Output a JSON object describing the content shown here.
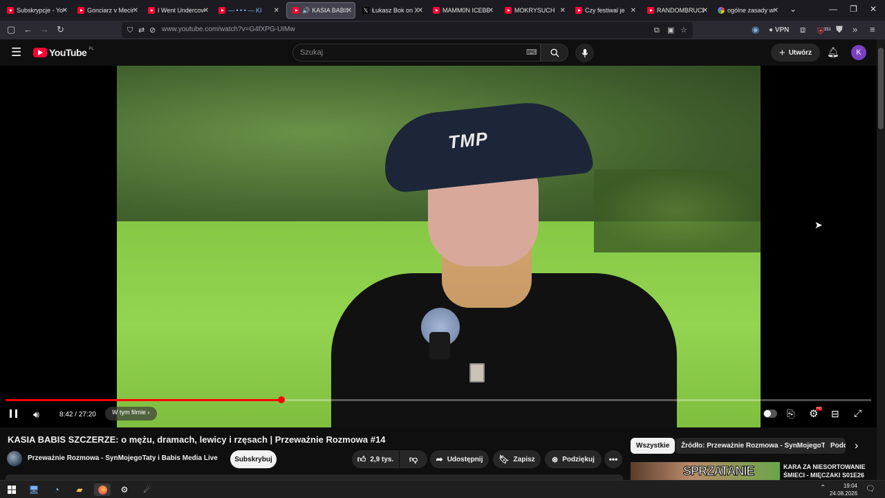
{
  "browser": {
    "tabs": [
      {
        "label": "Subskrypcje - YouT",
        "icon": "youtube-icon"
      },
      {
        "label": "Gonciarz v Mecins",
        "icon": "youtube-icon"
      },
      {
        "label": "I Went Undercove",
        "icon": "youtube-icon"
      },
      {
        "label": "— • • • — KI",
        "icon": "youtube-icon"
      },
      {
        "label": "KASIA BABIS S",
        "icon": "youtube-icon",
        "active": true
      },
      {
        "label": "Łukasz Bok on X: \"",
        "icon": "x-icon"
      },
      {
        "label": "MAMM0N ICEBER",
        "icon": "youtube-icon"
      },
      {
        "label": "MOKRYSUCH",
        "icon": "youtube-icon"
      },
      {
        "label": "Czy festiwal je",
        "icon": "youtube-icon"
      },
      {
        "label": "RANDOMBRUCE I",
        "icon": "youtube-icon"
      },
      {
        "label": "ogólne zasady wsp",
        "icon": "google-icon"
      }
    ],
    "url": "www.youtube.com/watch?v=G4fXPG-UIMw",
    "vpn_label": "VPN",
    "badge_count": "151"
  },
  "youtube": {
    "logo_text": "YouTube",
    "region": "PL",
    "search_placeholder": "Szukaj",
    "create_label": "Utwórz",
    "avatar_letter": "K"
  },
  "player": {
    "current_time": "8:42",
    "duration": "27:20",
    "progress_fraction": 0.3185,
    "chapter_label": "W tym filmie"
  },
  "video": {
    "title": "KASIA BABIS SZCZERZE: o mężu, dramach, lewicy i rzęsach | Przeważnie Rozmowa #14",
    "channel": "Przeważnie Rozmowa - SynMojegoTaty i Babis Media Live",
    "subscribe_label": "Subskrybuj",
    "likes": "2,9 tys.",
    "share_label": "Udostępnij",
    "save_label": "Zapisz",
    "thanks_label": "Podziękuj"
  },
  "chips": [
    "Wszystkie",
    "Źródło: Przeważnie Rozmowa - SynMojegoTaty",
    "Podo"
  ],
  "suggested": {
    "title": "KARA ZA NIESORTOWANIE ŚMIECI - MIĘCZAKI S01E26",
    "thumb_text": "SPRZATANIE"
  },
  "taskbar": {
    "time": "19:04",
    "date": "24.08.2026"
  },
  "colors": {
    "accent_red": "#ff0000",
    "avatar": "#7b3fc4"
  }
}
